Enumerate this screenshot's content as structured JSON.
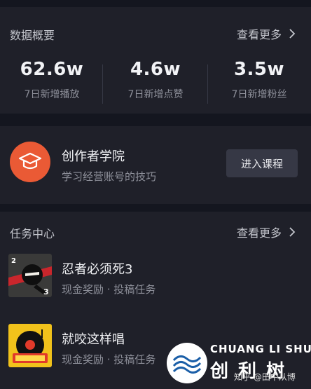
{
  "stats": {
    "title": "数据概要",
    "more": "查看更多",
    "items": [
      {
        "value": "62.6w",
        "label": "7日新增播放"
      },
      {
        "value": "4.6w",
        "label": "7日新增点赞"
      },
      {
        "value": "3.5w",
        "label": "7日新增粉丝"
      }
    ]
  },
  "academy": {
    "title": "创作者学院",
    "subtitle": "学习经营账号的技巧",
    "button": "进入课程",
    "icon": "graduation-cap-icon"
  },
  "tasks": {
    "title": "任务中心",
    "more": "查看更多",
    "items": [
      {
        "name": "忍者必须死3",
        "sub": "现金奖励 · 投稿任务",
        "thumb_icon": "ninja-game-thumbnail"
      },
      {
        "name": "就咬这样唱",
        "sub": "现金奖励 · 投稿任务",
        "thumb_icon": "music-game-thumbnail"
      }
    ]
  },
  "watermark": {
    "en": "CHUANG LI SHU",
    "cn": "创利树",
    "zhihu": "知乎 @田中从博"
  },
  "colors": {
    "background": "#14161f",
    "card": "#1f2029",
    "accent": "#ea5a35",
    "muted_text": "#8e909a"
  }
}
